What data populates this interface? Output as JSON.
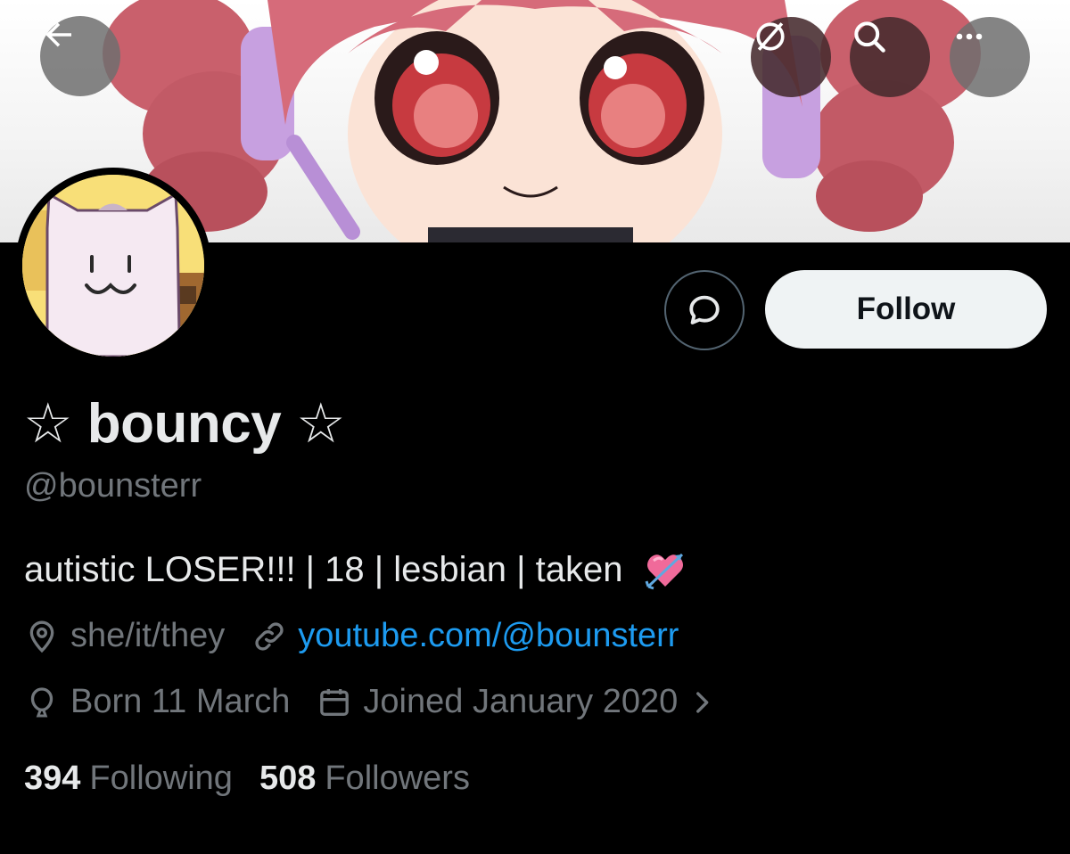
{
  "header": {
    "back_icon": "arrow-left-icon",
    "translate_icon": "translate-slash-icon",
    "search_icon": "search-icon",
    "more_icon": "more-horizontal-icon"
  },
  "profile": {
    "display_name": "☆ bouncy ☆",
    "handle": "@bounsterr",
    "bio": "autistic LOSER!!! | 18 | lesbian | taken",
    "bio_emoji": "heart-with-arrow",
    "location": "she/it/they",
    "website": "youtube.com/@bounsterr",
    "birthday": "Born 11 March",
    "joined": "Joined January 2020",
    "following_count": "394",
    "following_label": "Following",
    "followers_count": "508",
    "followers_label": "Followers"
  },
  "actions": {
    "follow_label": "Follow",
    "message_icon": "message-bubble-icon"
  },
  "colors": {
    "background": "#000000",
    "link": "#1d9bf0",
    "muted": "#71767b",
    "text": "#e7e9ea",
    "follow_bg": "#eff3f4"
  }
}
